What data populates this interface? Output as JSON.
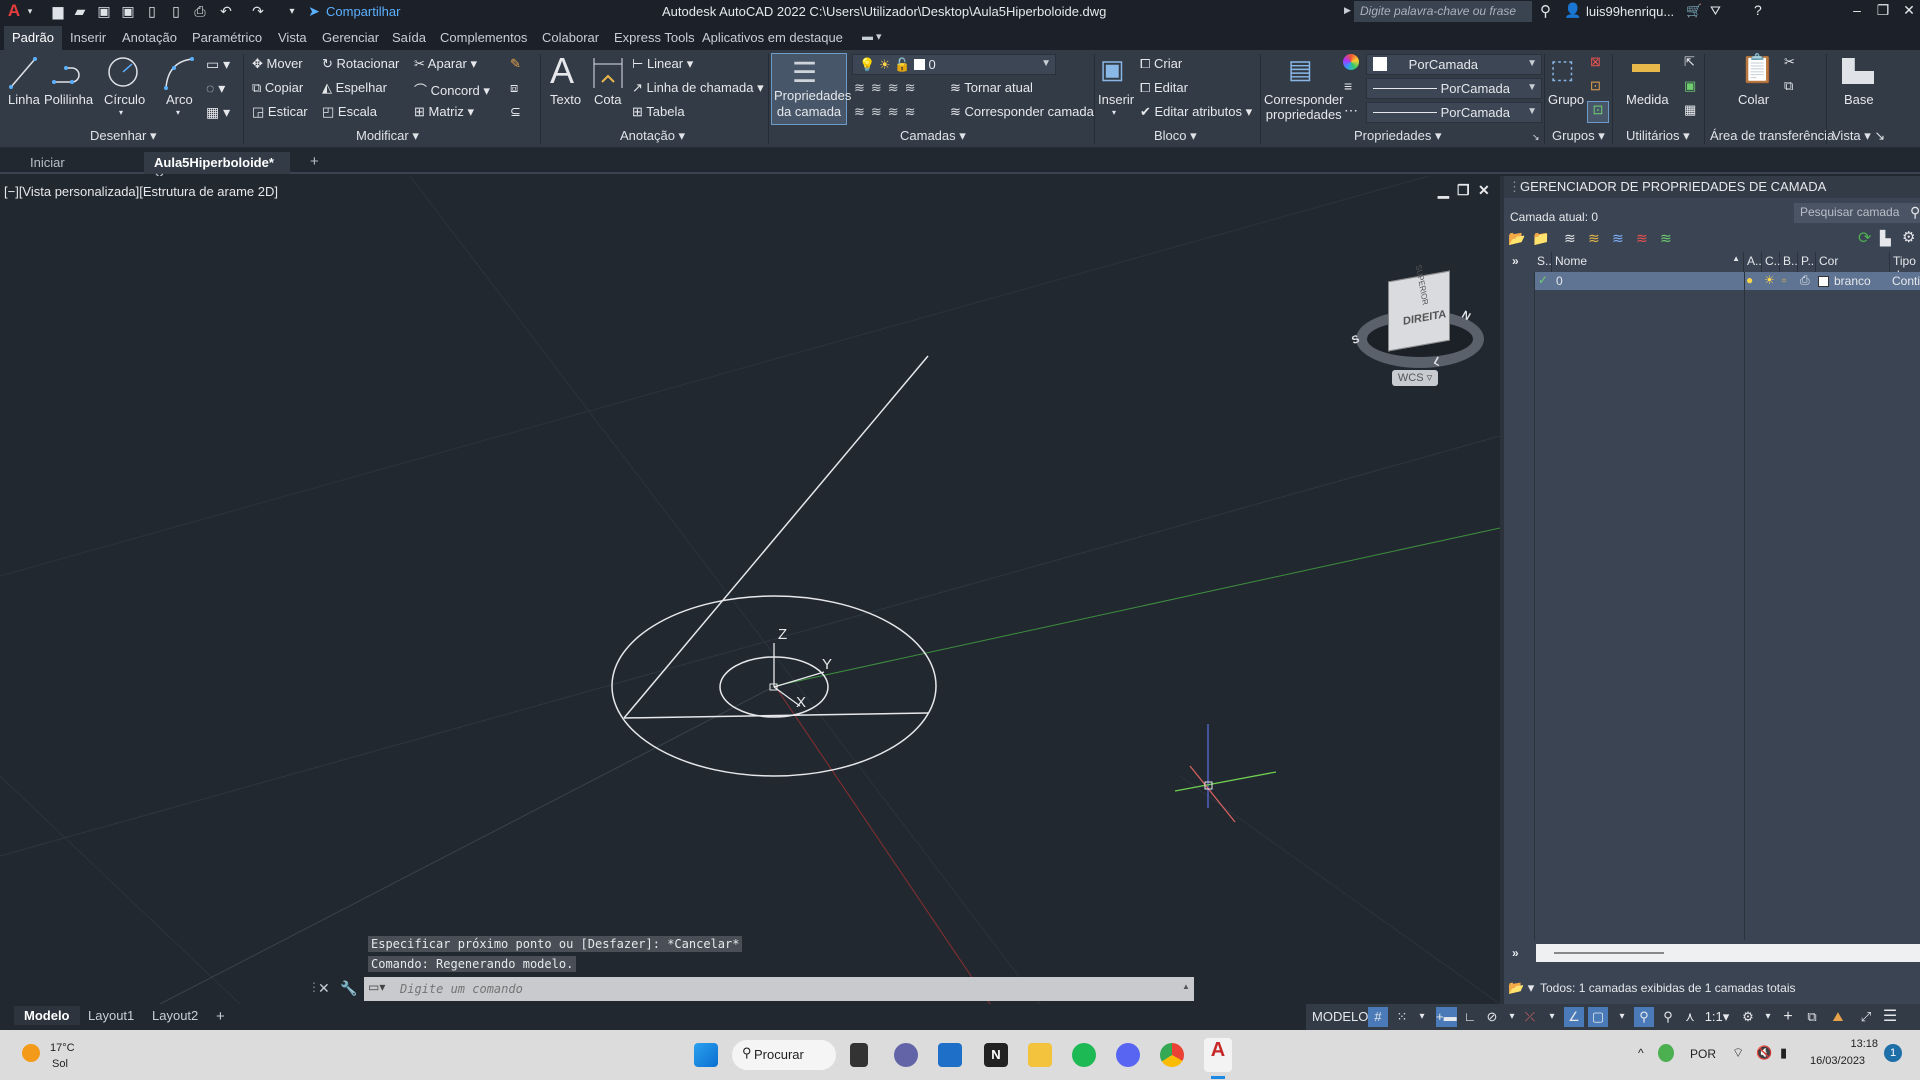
{
  "app": {
    "title": "Autodesk AutoCAD 2022   C:\\Users\\Utilizador\\Desktop\\Aula5Hiperboloide.dwg",
    "share_label": "Compartilhar",
    "search_placeholder": "Digite palavra-chave ou frase",
    "user": "luis99henriqu...",
    "quick_access": [
      "new-icon",
      "open-icon",
      "save-icon",
      "save-as-icon",
      "open-web-icon",
      "save-web-icon",
      "plot-icon",
      "undo-icon",
      "redo-icon",
      "customize-icon"
    ]
  },
  "menu_tabs": [
    "Padrão",
    "Inserir",
    "Anotação",
    "Paramétrico",
    "Vista",
    "Gerenciar",
    "Saída",
    "Complementos",
    "Colaborar",
    "Express Tools",
    "Aplicativos em destaque"
  ],
  "ribbon": {
    "desenhar": {
      "label": "Desenhar",
      "tools": [
        "Linha",
        "Polilinha",
        "Círculo",
        "Arco"
      ]
    },
    "modificar": {
      "label": "Modificar",
      "tools": [
        "Mover",
        "Rotacionar",
        "Aparar",
        "Copiar",
        "Espelhar",
        "Concord",
        "Esticar",
        "Escala",
        "Matriz"
      ]
    },
    "anotacao": {
      "label": "Anotação",
      "tools": [
        "Texto",
        "Cota",
        "Linear",
        "Linha de chamada",
        "Tabela"
      ]
    },
    "camadas": {
      "label": "Camadas",
      "big": "Propriedades da camada",
      "big_line1": "Propriedades",
      "big_line2": "da camada",
      "current_layer": "0",
      "tornar": "Tornar atual",
      "corresponder": "Corresponder camada"
    },
    "bloco": {
      "label": "Bloco",
      "inserir": "Inserir",
      "criar": "Criar",
      "editar": "Editar",
      "editar_atributos": "Editar atributos"
    },
    "propriedades": {
      "label": "Propriedades",
      "match_line1": "Corresponder",
      "match_line2": "propriedades",
      "color": "PorCamada",
      "lineweight": "PorCamada",
      "linetype": "PorCamada"
    },
    "grupos": {
      "label": "Grupos",
      "grupo": "Grupo"
    },
    "utilitarios": {
      "label": "Utilitários",
      "medida": "Medida"
    },
    "clipboard": {
      "label": "Área de transferência",
      "colar": "Colar"
    },
    "vista": {
      "label": "Vista",
      "base": "Base"
    }
  },
  "doc_tabs": [
    {
      "label": "Iniciar"
    },
    {
      "label": "Aula5Hiperboloide*"
    }
  ],
  "viewport": {
    "label": "[−][Vista personalizada][Estrutura de arame 2D]",
    "viewcube_face": "DIREITA",
    "viewcube_top": "SUPERIOR",
    "compass": {
      "n": "N",
      "s": "S",
      "l": "L"
    },
    "ucs_labels": {
      "x": "X",
      "y": "Y",
      "z": "Z"
    },
    "wcs": "WCS"
  },
  "command": {
    "history": [
      "Especificar próximo ponto ou [Desfazer]: *Cancelar*",
      "Comando:  Regenerando modelo."
    ],
    "placeholder": "Digite um comando"
  },
  "layout_tabs": [
    "Modelo",
    "Layout1",
    "Layout2"
  ],
  "status": {
    "model": "MODELO",
    "scale": "1:1"
  },
  "layer_palette": {
    "title": "GERENCIADOR DE PROPRIEDADES DE CAMADA",
    "current": "Camada atual: 0",
    "search_placeholder": "Pesquisar camada",
    "columns": [
      "S..",
      "Nome",
      "A..",
      "C..",
      "B..",
      "P..",
      "Cor",
      "Tipo d"
    ],
    "rows": [
      {
        "status": "✓",
        "name": "0",
        "color": "branco",
        "linetype": "Conti"
      }
    ],
    "footer": "Todos: 1 camadas exibidas de 1 camadas totais"
  },
  "taskbar": {
    "weather_temp": "17°C",
    "weather_desc": "Sol",
    "search": "Procurar",
    "lang": "POR",
    "time": "13:18",
    "date": "16/03/2023",
    "notif": "1",
    "apps": [
      "windows-start",
      "search",
      "task-view",
      "teams",
      "store",
      "notion",
      "explorer",
      "spotify",
      "discord",
      "chrome",
      "autocad"
    ]
  }
}
